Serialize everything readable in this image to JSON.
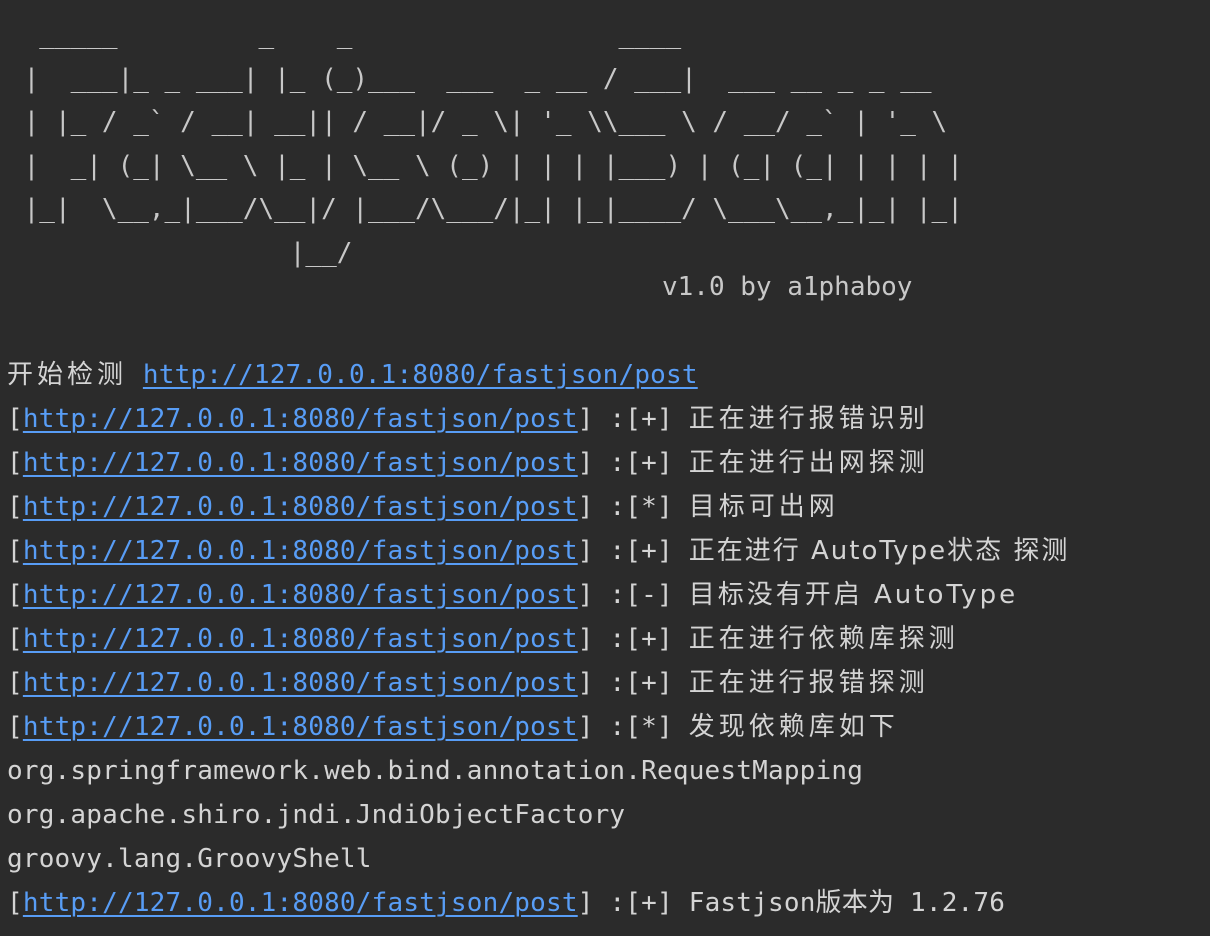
{
  "banner": {
    "art": "  _____         _    _                 ____\n |  ___|_ _ ___| |_ (_)___  ___  _ __ / ___|  ___ __ _ _ __\n | |_ / _` / __| __|| / __|/ _ \\| '_ \\\\___ \\ / __/ _` | '_ \\\n |  _| (_| \\__ \\ |_ | \\__ \\ (_) | | | |___) | (_| (_| | | | |\n |_|  \\__,_|___/\\__|/ |___/\\___/|_| |_|____/ \\___\\__,_|_| |_|\n                  |__/",
    "version": "v1.0 by a1phaboy"
  },
  "log": {
    "start_label": "开始检测",
    "start_url": "http://127.0.0.1:8080/fastjson/post",
    "bracket_open": "[",
    "bracket_close": "]",
    "entries": [
      {
        "url": "http://127.0.0.1:8080/fastjson/post",
        "tag": " :[+] ",
        "msg": "正在进行报错识别"
      },
      {
        "url": "http://127.0.0.1:8080/fastjson/post",
        "tag": " :[+] ",
        "msg": "正在进行出网探测"
      },
      {
        "url": "http://127.0.0.1:8080/fastjson/post",
        "tag": " :[*] ",
        "msg": "目标可出网"
      },
      {
        "url": "http://127.0.0.1:8080/fastjson/post",
        "tag": " :[+] ",
        "msg": "正在进行 AutoType状态 探测"
      },
      {
        "url": "http://127.0.0.1:8080/fastjson/post",
        "tag": " :[-] ",
        "msg": "目标没有开启 AutoType"
      },
      {
        "url": "http://127.0.0.1:8080/fastjson/post",
        "tag": " :[+] ",
        "msg": "正在进行依赖库探测"
      },
      {
        "url": "http://127.0.0.1:8080/fastjson/post",
        "tag": " :[+] ",
        "msg": "正在进行报错探测"
      },
      {
        "url": "http://127.0.0.1:8080/fastjson/post",
        "tag": " :[*] ",
        "msg": "发现依赖库如下"
      }
    ],
    "dependencies": [
      "org.springframework.web.bind.annotation.RequestMapping",
      "org.apache.shiro.jndi.JndiObjectFactory",
      "groovy.lang.GroovyShell"
    ],
    "final_entry": {
      "url": "http://127.0.0.1:8080/fastjson/post",
      "tag": " :[+] ",
      "msg": "Fastjson版本为 1.2.76"
    }
  },
  "colors": {
    "background": "#2b2b2b",
    "text": "#d4d4d4",
    "link": "#589df6"
  }
}
